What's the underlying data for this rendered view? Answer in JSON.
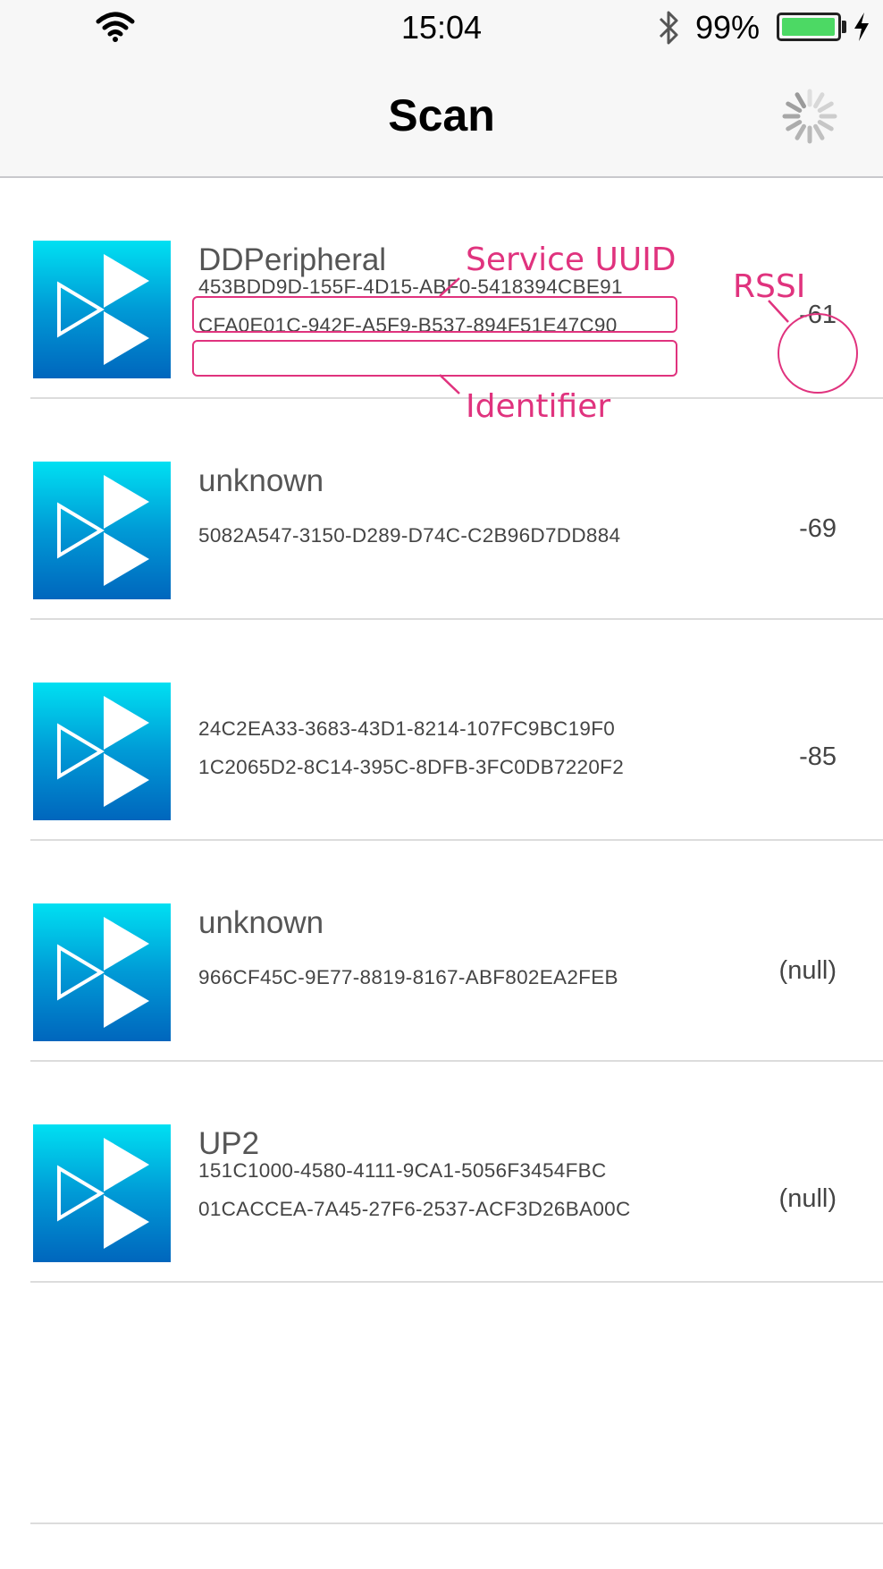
{
  "status_bar": {
    "time": "15:04",
    "battery_percent": "99%",
    "battery_level": 0.99,
    "icons": [
      "wifi-icon",
      "bluetooth-icon",
      "battery-icon",
      "charging-icon"
    ]
  },
  "nav": {
    "title": "Scan",
    "activity_icon": "spinner-icon"
  },
  "devices": [
    {
      "name": "DDPeripheral",
      "service_uuid": "453BDD9D-155F-4D15-ABF0-5418394CBE91",
      "identifier": "CFA0E01C-942F-A5F9-B537-894F51E47C90",
      "rssi": "-61"
    },
    {
      "name": "unknown",
      "service_uuid": "",
      "identifier": "5082A547-3150-D289-D74C-C2B96D7DD884",
      "rssi": "-69"
    },
    {
      "name": "",
      "service_uuid": "24C2EA33-3683-43D1-8214-107FC9BC19F0",
      "identifier": "1C2065D2-8C14-395C-8DFB-3FC0DB7220F2",
      "rssi": "-85"
    },
    {
      "name": "unknown",
      "service_uuid": "",
      "identifier": "966CF45C-9E77-8819-8167-ABF802EA2FEB",
      "rssi": "(null)"
    },
    {
      "name": "UP2",
      "service_uuid": "151C1000-4580-4111-9CA1-5056F3454FBC",
      "identifier": "01CACCEA-7A45-27F6-2537-ACF3D26BA00C",
      "rssi": "(null)"
    }
  ],
  "device_icon": "bluetooth-device-icon",
  "annotations": {
    "service_uuid": "Service UUID",
    "identifier": "Identifier",
    "rssi": "RSSI",
    "color": "#e0337e"
  },
  "colors": {
    "icon_gradient_top": "#00e0f2",
    "icon_gradient_bottom": "#0066bd",
    "battery_fill": "#4cd964"
  }
}
